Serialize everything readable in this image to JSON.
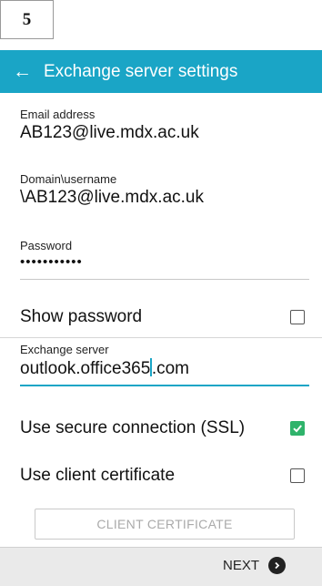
{
  "step": "5",
  "appbar": {
    "back_icon": "arrow-left-icon",
    "title": "Exchange server settings"
  },
  "fields": {
    "email": {
      "label": "Email address",
      "value": "AB123@live.mdx.ac.uk"
    },
    "domain_username": {
      "label": "Domain\\username",
      "value": "\\AB123@live.mdx.ac.uk"
    },
    "password": {
      "label": "Password",
      "value": "•••••••••••"
    },
    "exchange_server": {
      "label": "Exchange server",
      "value_before_caret": "outlook.office365",
      "value_after_caret": ".com"
    }
  },
  "options": {
    "show_password": {
      "label": "Show password",
      "checked": false
    },
    "use_ssl": {
      "label": "Use secure connection (SSL)",
      "checked": true
    },
    "client_cert": {
      "label": "Use client certificate",
      "checked": false
    }
  },
  "buttons": {
    "client_certificate": "CLIENT CERTIFICATE",
    "next": "NEXT"
  },
  "colors": {
    "accent": "#1aa5c6",
    "checkbox_checked": "#2fb36b"
  }
}
